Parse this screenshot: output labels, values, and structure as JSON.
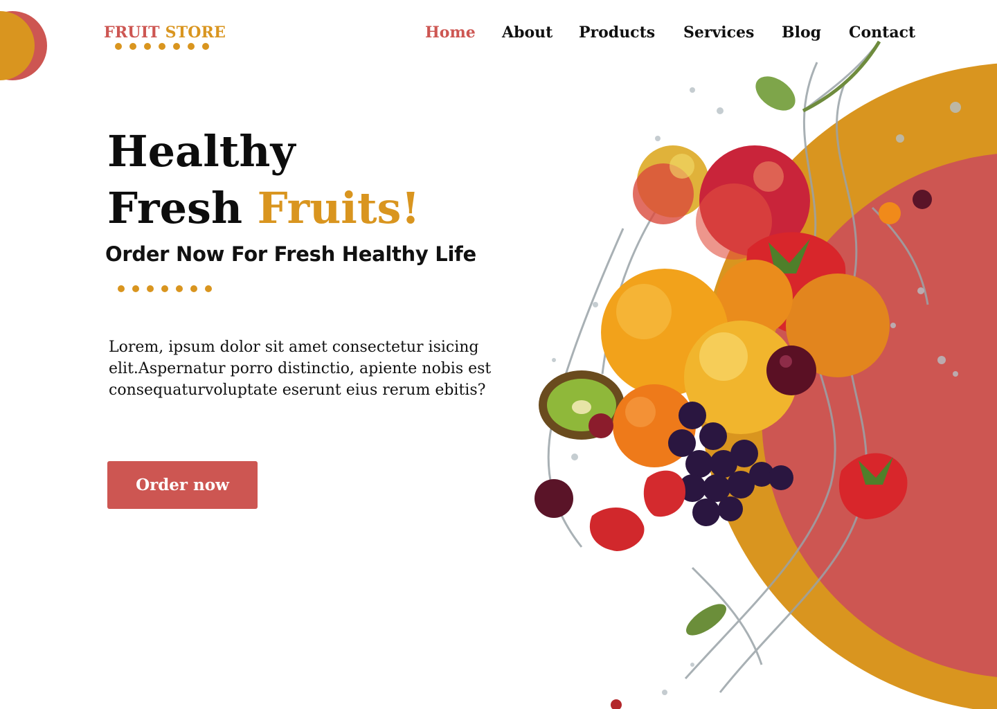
{
  "brand": {
    "logo_word1": "FRUIT",
    "logo_word2": "STORE",
    "primary_color": "#cd5652",
    "accent_color": "#d9951f"
  },
  "nav": {
    "items": [
      {
        "label": "Home",
        "active": true
      },
      {
        "label": "About",
        "active": false
      },
      {
        "label": "Products",
        "active": false
      },
      {
        "label": "Services",
        "active": false
      },
      {
        "label": "Blog",
        "active": false
      },
      {
        "label": "Contact",
        "active": false
      }
    ]
  },
  "hero": {
    "headline_line1": "Healthy",
    "headline_line2_plain": "Fresh",
    "headline_line2_accent": "Fruits!",
    "subtitle": "Order Now For Fresh Healthy Life",
    "body": "Lorem, ipsum dolor sit amet consectetur isicing elit.Aspernatur porro distinctio, apiente nobis est consequaturvoluptate eserunt eius rerum ebitis?",
    "cta_label": "Order now",
    "image_icon": "fruit-splash-illustration"
  }
}
